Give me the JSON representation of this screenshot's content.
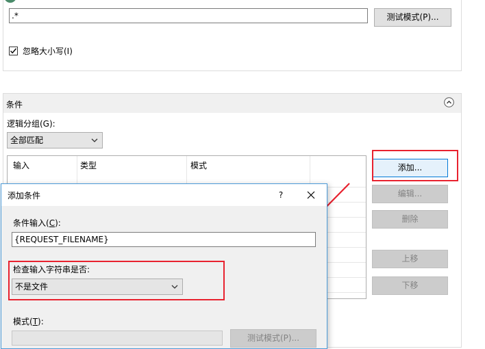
{
  "top_section": {
    "pattern_value": ".*",
    "test_pattern_button": "测试模式(P)...",
    "ignore_case_label": "忽略大小写(I)",
    "ignore_case_checked": true
  },
  "conditions": {
    "title": "条件",
    "logical_grouping_label": "逻辑分组(G):",
    "logical_grouping_value": "全部匹配",
    "columns": [
      "输入",
      "类型",
      "模式"
    ],
    "buttons": {
      "add": "添加...",
      "edit": "编辑...",
      "remove": "删除",
      "move_up": "上移",
      "move_down": "下移"
    }
  },
  "dialog": {
    "title": "添加条件",
    "help": "?",
    "condition_input_label_pre": "条件输入(",
    "condition_input_label_key": "C",
    "condition_input_label_post": "):",
    "condition_input_value": "{REQUEST_FILENAME}",
    "check_label": "检查输入字符串是否:",
    "check_value": "不是文件",
    "pattern_label_pre": "模式(",
    "pattern_label_key": "T",
    "pattern_label_post": "):",
    "pattern_value": "",
    "test_pattern_button": "测试模式(P)..."
  },
  "colors": {
    "highlight_red": "#e8212e",
    "accent_blue": "#0078d7"
  }
}
